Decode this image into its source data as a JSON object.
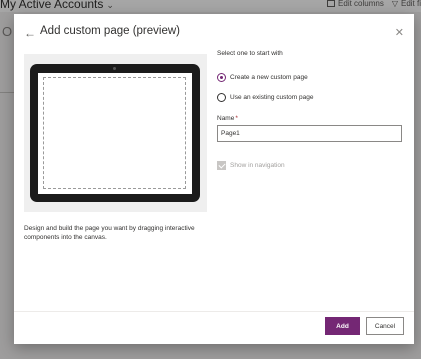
{
  "background": {
    "app_title": "My Active Accounts",
    "actions": [
      "Edit columns",
      "Edit fi"
    ],
    "left_partial": "O"
  },
  "dialog": {
    "title": "Add custom page (preview)",
    "back_icon": "arrow-left-icon",
    "close_icon": "close-icon",
    "description": "Design and build the page you want by dragging interactive components into the canvas.",
    "section_label": "Select one to start with",
    "options": [
      {
        "label": "Create a new custom page",
        "selected": true
      },
      {
        "label": "Use an existing custom page",
        "selected": false
      }
    ],
    "name_label": "Name",
    "name_required_mark": "*",
    "name_value": "Page1",
    "show_in_navigation_label": "Show in navigation",
    "show_in_navigation_checked": true,
    "show_in_navigation_disabled": true,
    "add_button": "Add",
    "cancel_button": "Cancel"
  },
  "colors": {
    "accent": "#742774",
    "overlay": "rgba(0,0,0,0.35)"
  }
}
